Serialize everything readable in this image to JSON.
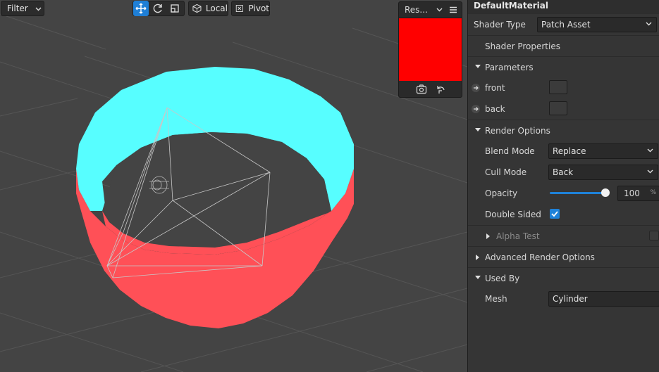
{
  "toolbar": {
    "filter_label": "Filter",
    "local_label": "Local",
    "pivot_label": "Pivot"
  },
  "preview": {
    "resolution_label": "Res...",
    "swatch_color": "#ff0000"
  },
  "scene": {
    "top_color": "#57feff",
    "side_color": "#ff5057",
    "background_color": "#444444"
  },
  "inspector": {
    "title": "DefaultMaterial",
    "shader_type_label": "Shader Type",
    "shader_type_value": "Patch Asset",
    "shader_properties_label": "Shader Properties",
    "parameters_label": "Parameters",
    "params": [
      {
        "label": "front"
      },
      {
        "label": "back"
      }
    ],
    "render_options_label": "Render Options",
    "blend_mode_label": "Blend Mode",
    "blend_mode_value": "Replace",
    "cull_mode_label": "Cull Mode",
    "cull_mode_value": "Back",
    "opacity_label": "Opacity",
    "opacity_value": "100",
    "opacity_unit": "%",
    "opacity_fraction": 1.0,
    "double_sided_label": "Double Sided",
    "double_sided_checked": true,
    "alpha_test_label": "Alpha Test",
    "advanced_label": "Advanced Render Options",
    "used_by_label": "Used By",
    "mesh_label": "Mesh",
    "mesh_value": "Cylinder"
  }
}
